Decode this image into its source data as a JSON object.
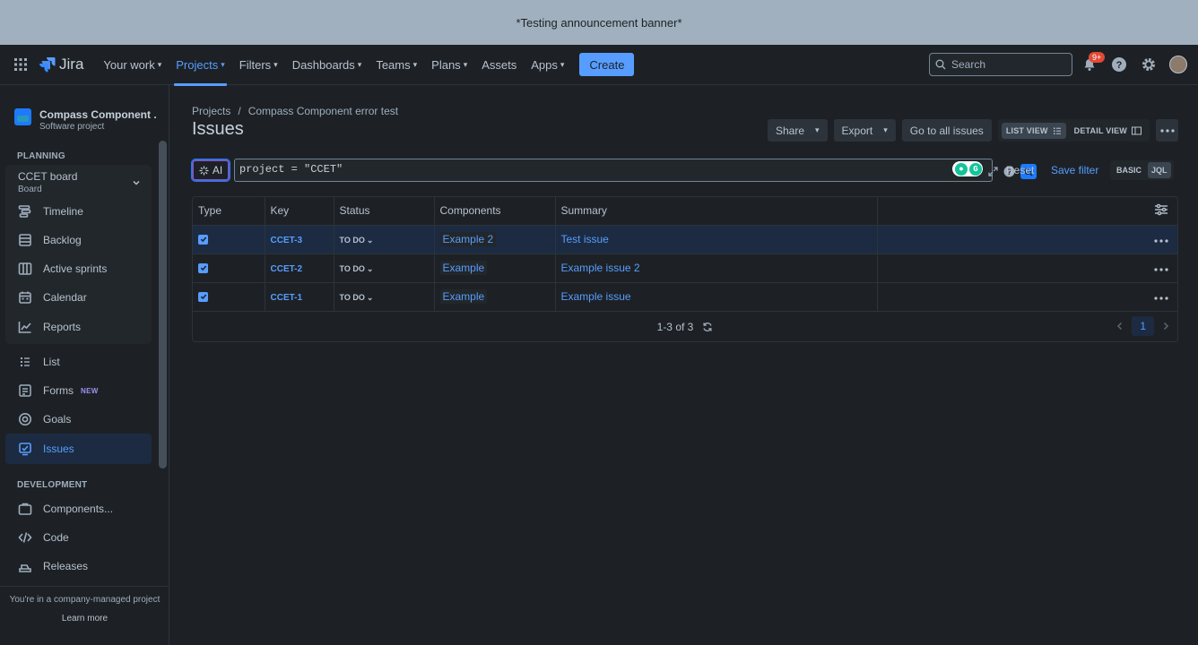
{
  "banner": {
    "text": "*Testing announcement banner*"
  },
  "topnav": {
    "logo": "Jira",
    "items": [
      {
        "label": "Your work"
      },
      {
        "label": "Projects"
      },
      {
        "label": "Filters"
      },
      {
        "label": "Dashboards"
      },
      {
        "label": "Teams"
      },
      {
        "label": "Plans"
      },
      {
        "label": "Assets"
      },
      {
        "label": "Apps"
      }
    ],
    "create_label": "Create",
    "search_placeholder": "Search",
    "notif_badge": "9+"
  },
  "sidebar": {
    "project_name": "Compass Component ...",
    "project_type": "Software project",
    "planning_title": "PLANNING",
    "board_name": "CCET board",
    "board_sub": "Board",
    "planning_items": [
      {
        "label": "Timeline"
      },
      {
        "label": "Backlog"
      },
      {
        "label": "Active sprints"
      },
      {
        "label": "Calendar"
      },
      {
        "label": "Reports"
      }
    ],
    "items": [
      {
        "label": "List"
      },
      {
        "label": "Forms",
        "badge": "NEW"
      },
      {
        "label": "Goals"
      },
      {
        "label": "Issues"
      }
    ],
    "development_title": "DEVELOPMENT",
    "dev_items": [
      {
        "label": "Components..."
      },
      {
        "label": "Code"
      },
      {
        "label": "Releases"
      }
    ],
    "footer_text": "You're in a company-managed project",
    "learn_more": "Learn more"
  },
  "main": {
    "breadcrumbs": [
      "Projects",
      "/",
      "Compass Component error test"
    ],
    "title": "Issues",
    "share": "Share",
    "export": "Export",
    "go_all": "Go to all issues",
    "list_view": "LIST VIEW",
    "detail_view": "DETAIL VIEW",
    "ai_label": "AI",
    "jql_query": "project = \"CCET\"",
    "reset": "Reset",
    "save_filter": "Save filter",
    "mode_basic": "BASIC",
    "mode_jql": "JQL"
  },
  "table": {
    "headers": [
      "Type",
      "Key",
      "Status",
      "Components",
      "Summary"
    ],
    "rows": [
      {
        "key": "CCET-3",
        "status": "TO DO",
        "component": "Example 2",
        "summary": "Test issue"
      },
      {
        "key": "CCET-2",
        "status": "TO DO",
        "component": "Example",
        "summary": "Example issue 2"
      },
      {
        "key": "CCET-1",
        "status": "TO DO",
        "component": "Example",
        "summary": "Example issue"
      }
    ],
    "count": "1-3 of 3",
    "page": "1"
  },
  "colors": {
    "accent": "#579dff",
    "bg": "#1d2125",
    "banner": "#a1b0bf"
  }
}
